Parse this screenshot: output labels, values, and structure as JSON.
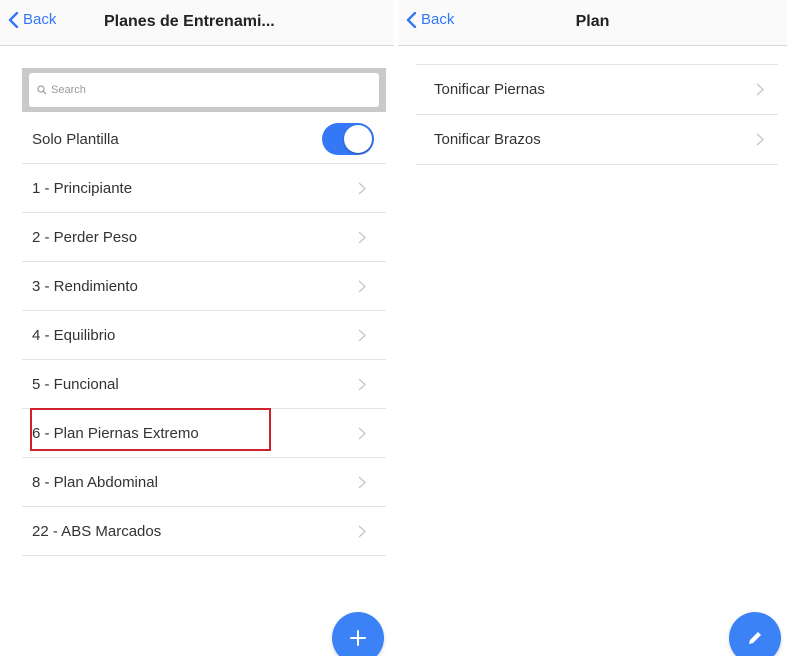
{
  "left": {
    "back_label": "Back",
    "title": "Planes de Entrenami...",
    "search_placeholder": "Search",
    "solo_plantilla": {
      "label": "Solo Plantilla",
      "on": true
    },
    "items": [
      {
        "label": "1 - Principiante"
      },
      {
        "label": "2 - Perder Peso"
      },
      {
        "label": "3 - Rendimiento"
      },
      {
        "label": "4 - Equilibrio"
      },
      {
        "label": "5 - Funcional"
      },
      {
        "label": "6 - Plan Piernas Extremo",
        "highlighted": true
      },
      {
        "label": "8 - Plan Abdominal"
      },
      {
        "label": "22 - ABS Marcados"
      }
    ],
    "fab_icon": "add-icon"
  },
  "right": {
    "back_label": "Back",
    "title": "Plan",
    "items": [
      {
        "label": "Tonificar Piernas"
      },
      {
        "label": "Tonificar Brazos"
      }
    ],
    "fab_icon": "pencil-icon"
  },
  "colors": {
    "accent": "#3478f6",
    "highlight_border": "#d0222d"
  }
}
